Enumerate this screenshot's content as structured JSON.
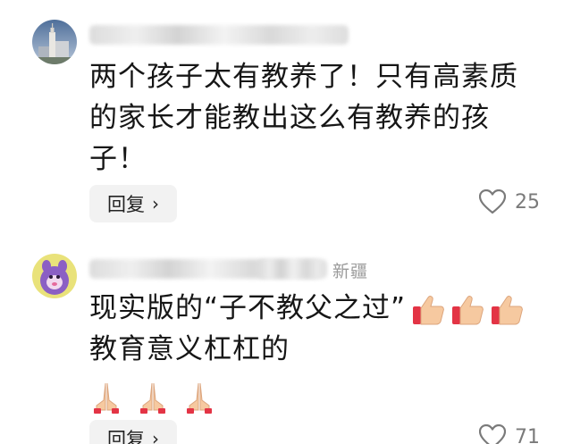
{
  "comments": [
    {
      "username": "",
      "location": "",
      "lines": [
        "两个孩子太有教养了！只有高素质",
        "的家长才能教出这么有教养的孩",
        "子！"
      ],
      "reply_label": "回复",
      "likes": "25",
      "avatar_icon": "building-tower-icon"
    },
    {
      "username": "",
      "location": "新疆",
      "lines": [
        "现实版的“子不教父之过”",
        "教育意义杠杠的"
      ],
      "emoji_line1": [
        "thumbs-up-icon",
        "thumbs-up-icon",
        "thumbs-up-icon"
      ],
      "emoji_line3": [
        "folded-hands-icon",
        "folded-hands-icon",
        "folded-hands-icon"
      ],
      "reply_label": "回复",
      "likes": "71",
      "avatar_icon": "cartoon-character-icon"
    }
  ],
  "colors": {
    "text": "#161616",
    "muted": "#9a9a9a",
    "reply_bg": "#f2f2f2",
    "like_gray": "#7a7a7a"
  }
}
